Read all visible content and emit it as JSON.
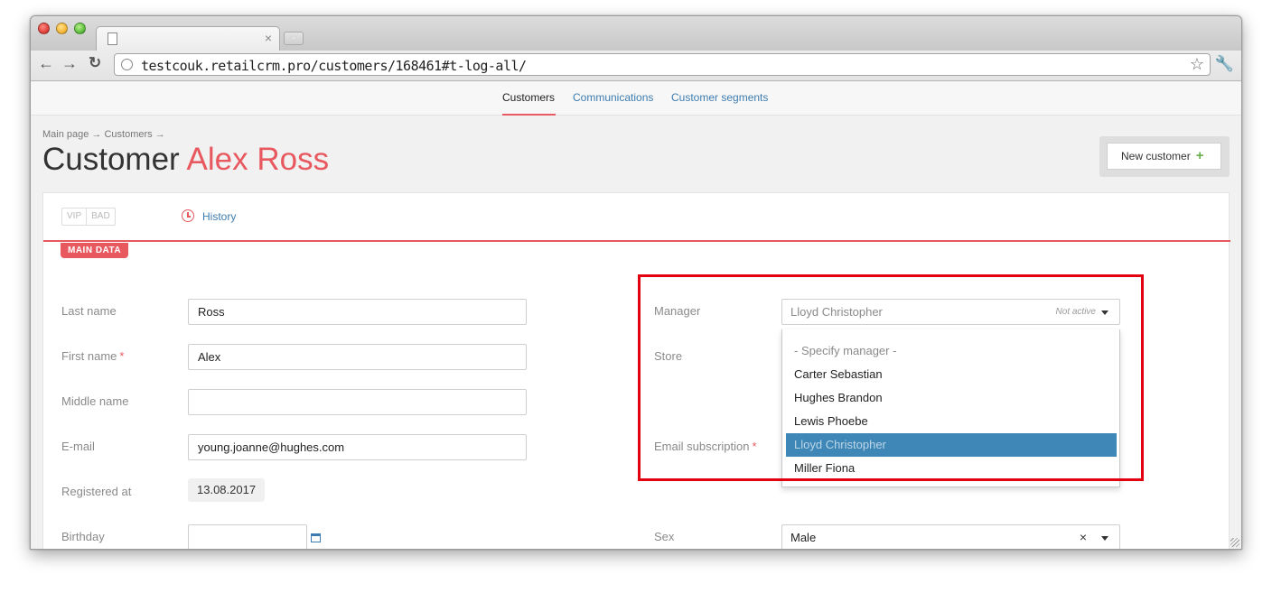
{
  "browser": {
    "address": "testcouk.retailcrm.pro/customers/168461#t-log-all/"
  },
  "topnav": {
    "items": [
      {
        "label": "Customers",
        "active": true
      },
      {
        "label": "Communications",
        "active": false
      },
      {
        "label": "Customer segments",
        "active": false
      }
    ]
  },
  "breadcrumb": "Main page → Customers →",
  "title": {
    "prefix": "Customer",
    "name": "Alex Ross"
  },
  "new_customer": {
    "label": "New customer",
    "icon": "+"
  },
  "tags": [
    "VIP",
    "BAD"
  ],
  "history_label": "History",
  "section_label": "MAIN DATA",
  "form": {
    "last_name": {
      "label": "Last name",
      "value": "Ross"
    },
    "first_name": {
      "label": "First name",
      "value": "Alex",
      "required": "*"
    },
    "middle_name": {
      "label": "Middle name",
      "value": ""
    },
    "email": {
      "label": "E-mail",
      "value": "young.joanne@hughes.com"
    },
    "registered": {
      "label": "Registered at",
      "value": "13.08.2017"
    },
    "birthday": {
      "label": "Birthday",
      "value": ""
    },
    "manager": {
      "label": "Manager",
      "value": "Lloyd Christopher",
      "status": "Not active"
    },
    "store": {
      "label": "Store"
    },
    "email_subscription": {
      "label": "Email subscription",
      "required": "*"
    },
    "sex": {
      "label": "Sex",
      "value": "Male",
      "clear": "×"
    }
  },
  "manager_dropdown": {
    "options": [
      "- Specify manager -",
      "Carter Sebastian",
      "Hughes Brandon",
      "Lewis Phoebe",
      "Lloyd Christopher",
      "Miller Fiona"
    ],
    "selected": "Lloyd Christopher"
  },
  "colors": {
    "accent": "#e8585f",
    "link": "#3d7cb0",
    "selected_option": "#3f87b6",
    "highlight_box": "#e3000f"
  }
}
